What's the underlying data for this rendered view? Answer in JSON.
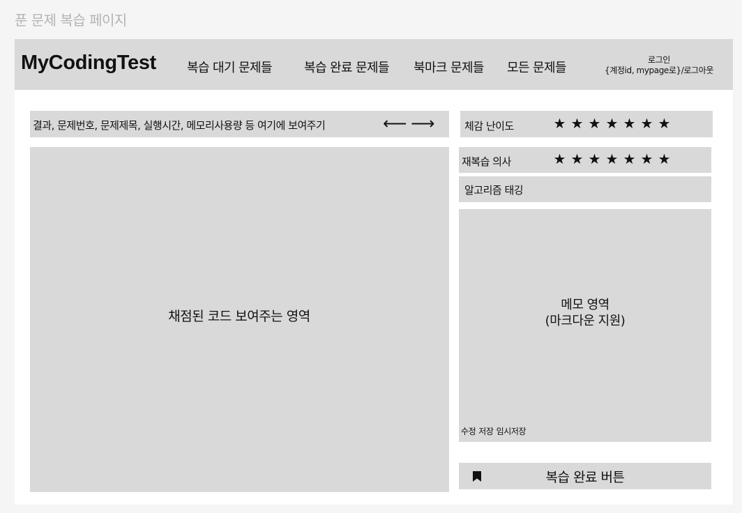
{
  "page_label": "푼 문제 복습 페이지",
  "header": {
    "logo": "MyCodingTest",
    "nav": [
      {
        "label": "복습 대기 문제들"
      },
      {
        "label": "복습 완료 문제들"
      },
      {
        "label": "북마크 문제들"
      },
      {
        "label": "모든 문제들"
      }
    ],
    "login_label": "로그인",
    "account_label": "{계정id, mypage로}/로그아웃"
  },
  "info_bar": {
    "text": "결과, 문제번호, 문제제목, 실행시간, 메모리사용량 등 여기에 보여주기",
    "prev_arrow": "⟵",
    "next_arrow": "⟶"
  },
  "code_area": {
    "label": "채점된 코드 보여주는 영역"
  },
  "difficulty": {
    "label": "체감 난이도",
    "stars": [
      "★",
      "★",
      "★",
      "★",
      "★",
      "★",
      "★"
    ]
  },
  "re_review": {
    "label": "재복습  의사",
    "stars": [
      "★",
      "★",
      "★",
      "★",
      "★",
      "★",
      "★"
    ]
  },
  "algorithm_tag": {
    "label": "알고리즘 태깅"
  },
  "memo": {
    "title_line1": "메모 영역",
    "title_line2": "(마크다운 지원)",
    "actions": [
      "수정",
      "저장",
      "임시저장"
    ]
  },
  "review_complete": {
    "label": "복습 완료 버튼",
    "icon": "bookmark-icon"
  }
}
